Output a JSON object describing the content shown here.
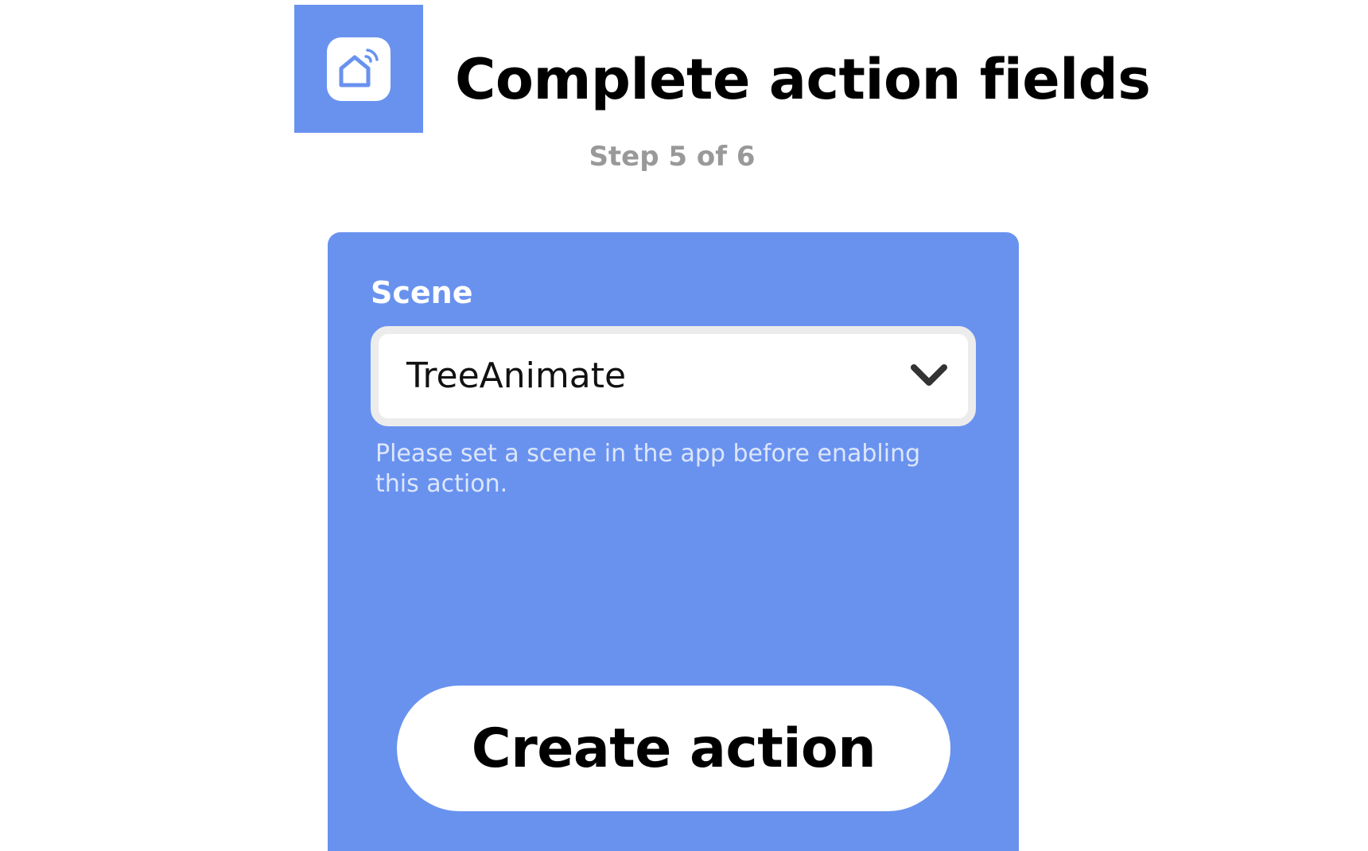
{
  "theme": {
    "accent": "#6992ef"
  },
  "header": {
    "app_icon": "smart-home-icon",
    "title": "Complete action fields",
    "step": "Step 5 of 6"
  },
  "form": {
    "field_label": "Scene",
    "select_value": "TreeAnimate",
    "select_icon": "chevron-down-icon",
    "helper_text": "Please set a scene in the app before enabling this action.",
    "submit_label": "Create action"
  }
}
